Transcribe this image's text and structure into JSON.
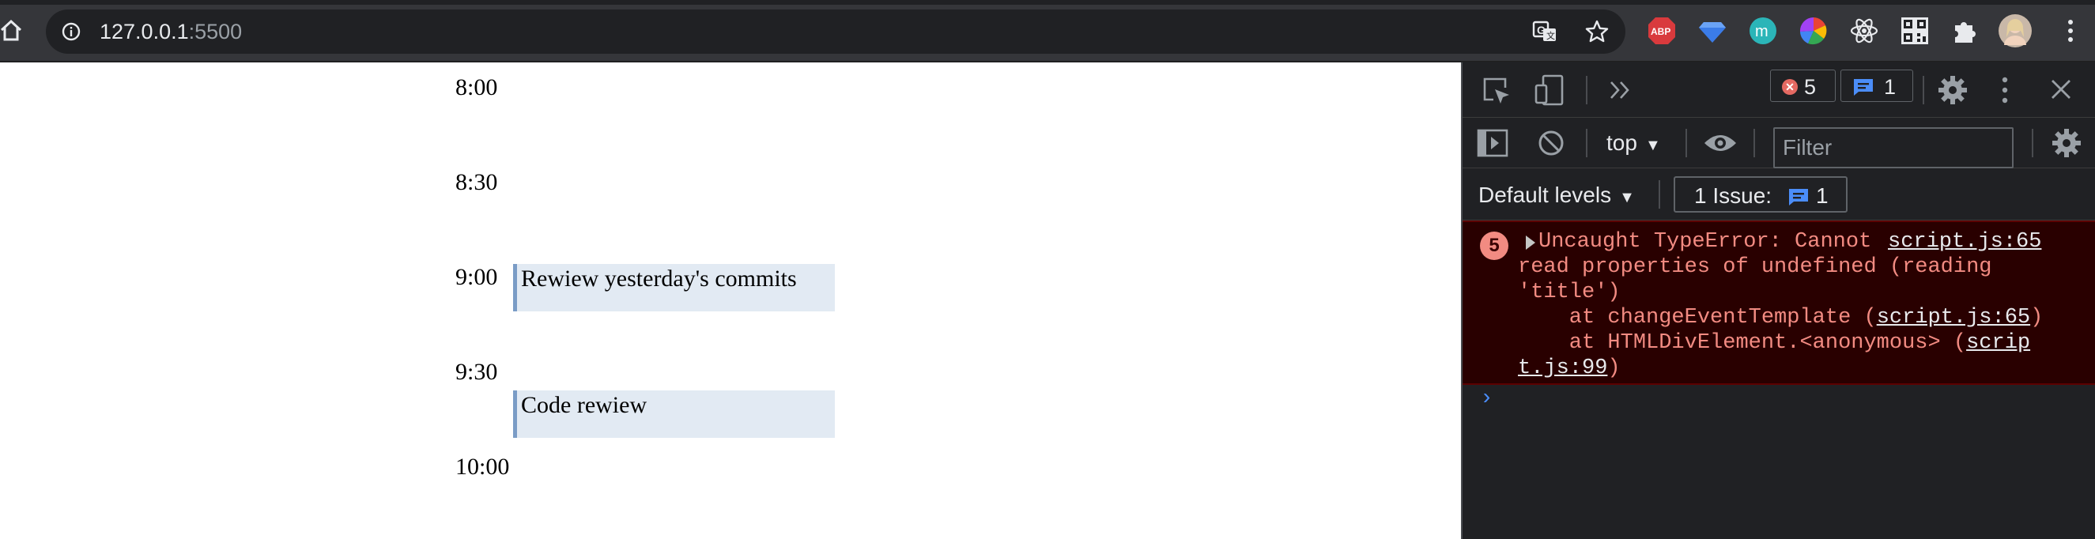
{
  "browser": {
    "url_host": "127.0.0.1",
    "url_port": ":5500",
    "extensions": [
      {
        "name": "adblock-plus-icon",
        "text": "ABP",
        "color": "#d93a3d"
      },
      {
        "name": "gem-extension-icon",
        "color": "#3b7ce8"
      },
      {
        "name": "m-extension-icon",
        "text": "m",
        "color": "#2bb5b8"
      },
      {
        "name": "color-picker-icon"
      },
      {
        "name": "react-devtools-icon",
        "color": "#61dafb"
      },
      {
        "name": "qr-code-icon"
      },
      {
        "name": "extensions-puzzle-icon"
      },
      {
        "name": "profile-avatar"
      },
      {
        "name": "menu-kebab-icon"
      }
    ]
  },
  "calendar": {
    "times": [
      "8:00",
      "8:30",
      "9:00",
      "9:30",
      "10:00"
    ],
    "events": [
      {
        "title": "Rewiew yesterday's commits"
      },
      {
        "title": "Code rewiew"
      }
    ],
    "event_bg": "#e2eaf3",
    "event_border": "#7a9cc6"
  },
  "devtools": {
    "error_count": "5",
    "message_count": "1",
    "context": "top",
    "filter_placeholder": "Filter",
    "levels_label": "Default levels",
    "issues_label": "1 Issue:",
    "issues_count": "1",
    "error": {
      "count": "5",
      "line1": "Uncaught TypeError: Cannot",
      "source": "script.js:65",
      "line2": "read properties of undefined (reading",
      "line3": "'title')",
      "line4_prefix": "    at changeEventTemplate (",
      "line4_link": "script.js:65",
      "line4_suffix": ")",
      "line5_prefix": "    at HTMLDivElement.<anonymous> (",
      "line5_link": "scrip",
      "line6_link": "t.js:99",
      "line6_suffix": ")"
    },
    "prompt": "›"
  }
}
